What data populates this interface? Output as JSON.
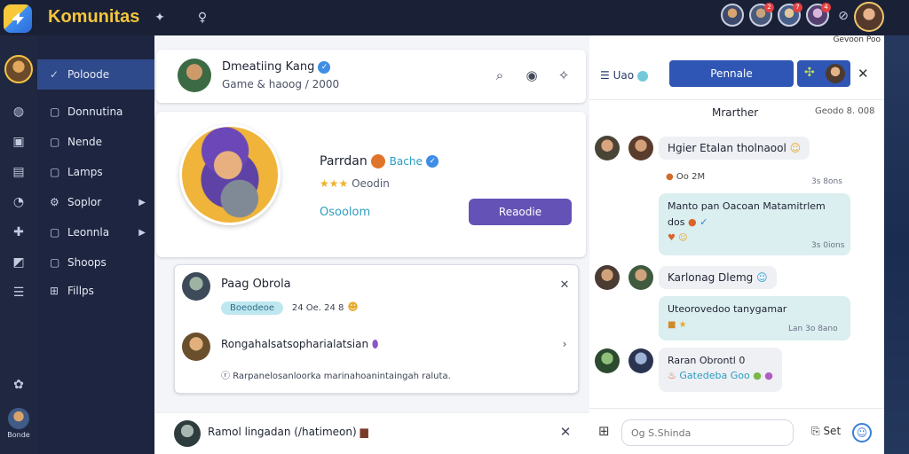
{
  "brand": "Komunitas",
  "topbar": {
    "tab_label": "Gevoon Poo",
    "badges": [
      "2",
      "7",
      "4"
    ]
  },
  "rail": {
    "user_label": "Bonde"
  },
  "sidenav": {
    "items": [
      {
        "label": "Poloode",
        "active": true
      },
      {
        "label": "Donnutina"
      },
      {
        "label": "Nende"
      },
      {
        "label": "Lamps"
      },
      {
        "label": "Soplor",
        "has_children": true
      },
      {
        "label": "Leonnla",
        "has_children": true
      },
      {
        "label": "Shoops"
      },
      {
        "label": "Fillps"
      }
    ]
  },
  "post_header": {
    "title": "Dmeatiing Kang",
    "subtitle": "Game & haoog / 2000"
  },
  "profile": {
    "name": "Parrdan",
    "badge_text": "Bache",
    "rating_text": "Oeodin",
    "link_text": "Osoolom",
    "action_label": "Reaodie"
  },
  "request_card": {
    "name": "Paag Obrola",
    "chip": "Boeodeoe",
    "meta": "24 Oe. 24 8",
    "item2_title": "Rongahalsatsopharialatsian",
    "item2_desc": "Rarpanelosanloorka marinahoanintaingah raluta."
  },
  "bottom_bar": {
    "title": "Ramol lingadan (/hatimeon)"
  },
  "chat": {
    "filter_label": "Uao",
    "primary_button": "Pennale",
    "section_title": "Mrarther",
    "section_date": "Geodo 8. 008",
    "messages": [
      {
        "text": "Hgier Etalan tholnaool",
        "meta": "Oo 2M",
        "time": "3s 8ons"
      },
      {
        "text": "Manto pan Oacoan Matamitrlem dos",
        "meta": "",
        "time": "3s 0ions"
      },
      {
        "text": "Karlonag Dlemg",
        "meta": "",
        "time": ""
      },
      {
        "text": "Uteorovedoo tanygamar",
        "meta": "",
        "time": "Lan 3o 8ano"
      },
      {
        "text": "Raran Obrontl 0",
        "meta": "Gatedeba Goo",
        "time": ""
      }
    ],
    "input_placeholder": "Og S.Shinda",
    "send_label": "Set"
  }
}
